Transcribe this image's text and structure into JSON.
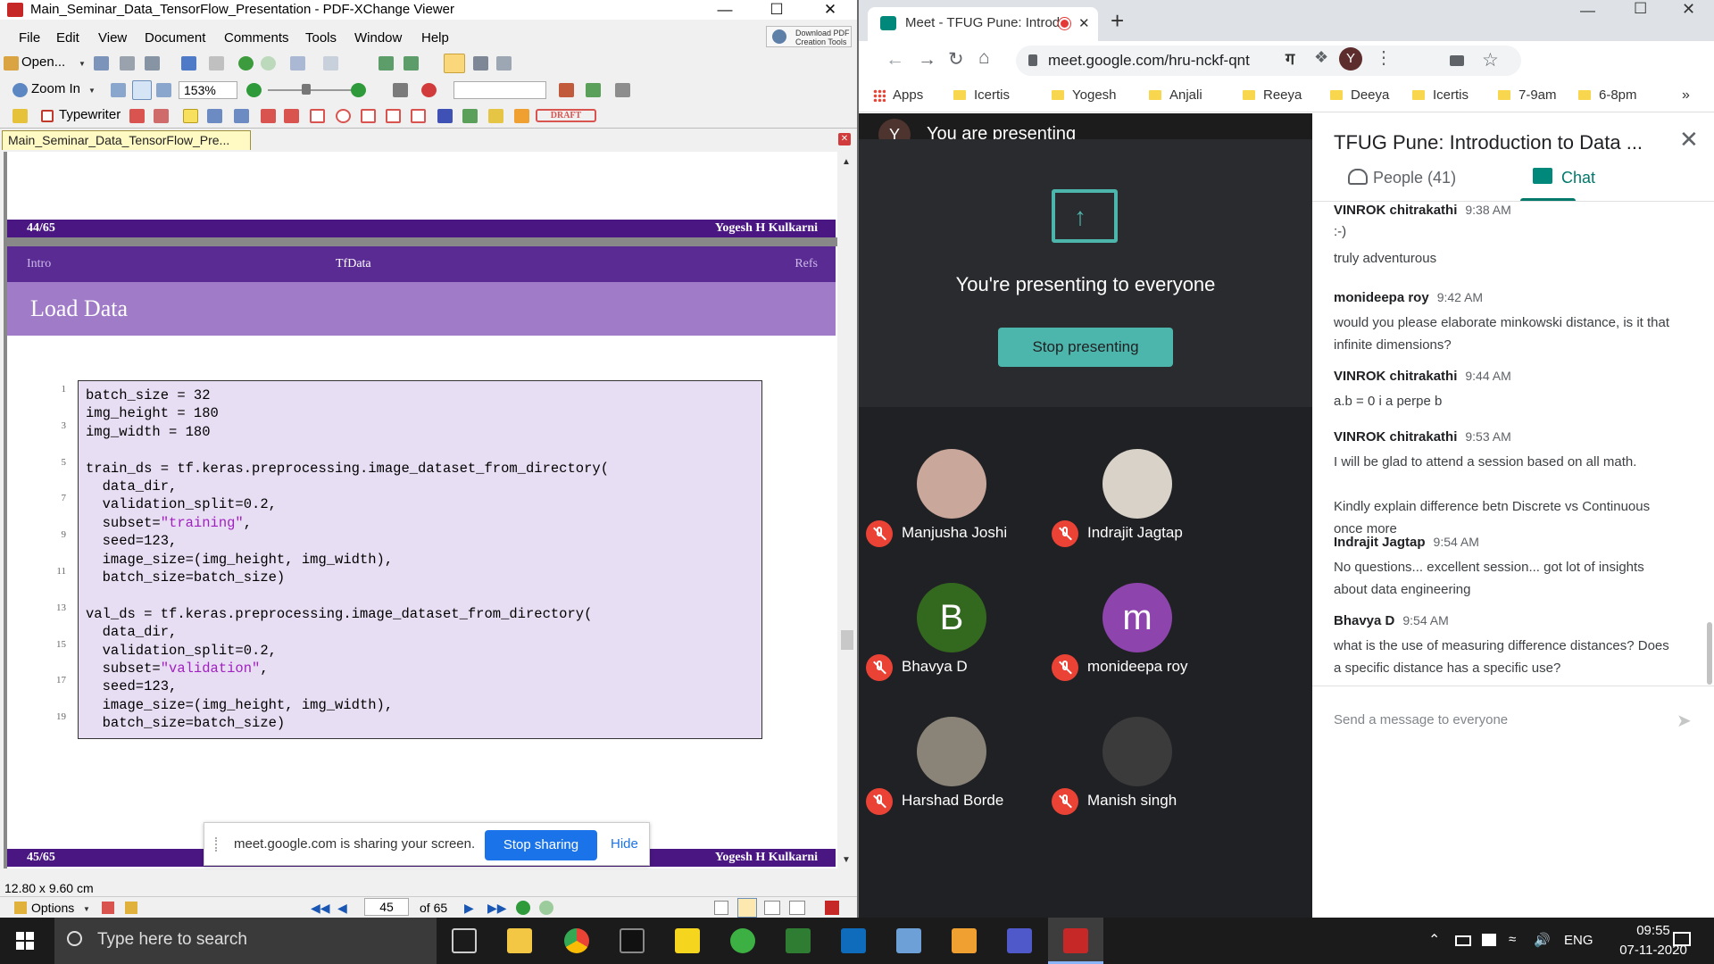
{
  "pdf": {
    "window_title": "Main_Seminar_Data_TensorFlow_Presentation - PDF-XChange Viewer",
    "menu": [
      "File",
      "Edit",
      "View",
      "Document",
      "Comments",
      "Tools",
      "Window",
      "Help"
    ],
    "open_label": "Open...",
    "download_label": "Download PDF Creation Tools",
    "zoom_label": "Zoom In",
    "zoom_value": "153%",
    "typewriter_label": "Typewriter",
    "draft_label": "DRAFT",
    "doc_tab": "Main_Seminar_Data_TensorFlow_Pre...",
    "page_prev_footer": {
      "page": "44/65",
      "author": "Yogesh H Kulkarni"
    },
    "slide_nav": {
      "left": "Intro",
      "center": "TfData",
      "right": "Refs"
    },
    "slide_title": "Load Data",
    "code_lines": [
      {
        "num": "1",
        "text": "batch_size = 32"
      },
      {
        "num": "",
        "text": "img_height = 180"
      },
      {
        "num": "3",
        "text": "img_width = 180"
      },
      {
        "num": "",
        "text": ""
      },
      {
        "num": "5",
        "text": "train_ds = tf.keras.preprocessing.image_dataset_from_directory("
      },
      {
        "num": "",
        "text": "  data_dir,"
      },
      {
        "num": "7",
        "text": "  validation_split=0.2,"
      },
      {
        "num": "",
        "pre": "  subset=",
        "str": "\"training\"",
        "post": ","
      },
      {
        "num": "9",
        "text": "  seed=123,"
      },
      {
        "num": "",
        "text": "  image_size=(img_height, img_width),"
      },
      {
        "num": "11",
        "text": "  batch_size=batch_size)"
      },
      {
        "num": "",
        "text": ""
      },
      {
        "num": "13",
        "text": "val_ds = tf.keras.preprocessing.image_dataset_from_directory("
      },
      {
        "num": "",
        "text": "  data_dir,"
      },
      {
        "num": "15",
        "text": "  validation_split=0.2,"
      },
      {
        "num": "",
        "pre": "  subset=",
        "str": "\"validation\"",
        "post": ","
      },
      {
        "num": "17",
        "text": "  seed=123,"
      },
      {
        "num": "",
        "text": "  image_size=(img_height, img_width),"
      },
      {
        "num": "19",
        "text": "  batch_size=batch_size)"
      }
    ],
    "page_cur_footer": {
      "page": "45/65",
      "author": "Yogesh H Kulkarni"
    },
    "share_notice": "meet.google.com is sharing your screen.",
    "stop_sharing": "Stop sharing",
    "hide": "Hide",
    "page_size": "12.80 x 9.60 cm",
    "options_label": "Options",
    "page_number": "45",
    "page_total": "of 65"
  },
  "chrome": {
    "tab_title": "Meet - TFUG Pune: Introducti",
    "url": "meet.google.com/hru-nckf-qnt",
    "profile_initial": "Y",
    "bookmarks": [
      "Apps",
      "Icertis",
      "Yogesh",
      "Anjali",
      "Reeya",
      "Deeya",
      "Icertis",
      "7-9am",
      "6-8pm"
    ]
  },
  "meet": {
    "presenter_initial": "Y",
    "presenting_header": "You are presenting",
    "presenting_msg": "You're presenting to everyone",
    "stop_presenting": "Stop presenting",
    "participants": [
      {
        "name": "Manjusha Joshi",
        "initial": "",
        "color": "#c9a79a"
      },
      {
        "name": "Indrajit Jagtap",
        "initial": "",
        "color": "#d8d2c8"
      },
      {
        "name": "Bhavya D",
        "initial": "B",
        "color": "#33691e"
      },
      {
        "name": "monideepa roy",
        "initial": "m",
        "color": "#8e44ad"
      },
      {
        "name": "Harshad Borde",
        "initial": "",
        "color": "#8a8478"
      },
      {
        "name": "Manish singh",
        "initial": "",
        "color": "#3b3b3b"
      }
    ],
    "meeting_title": "TFUG Pune: Introduction to Data ...",
    "people_tab": "People (41)",
    "chat_tab": "Chat",
    "chat": [
      {
        "name": "VINROK chitrakathi",
        "time": "9:38 AM",
        "lines": [
          ":-)",
          "truly adventurous"
        ]
      },
      {
        "name": "monideepa roy",
        "time": "9:42 AM",
        "lines": [
          "would you please elaborate minkowski distance, is it that infinite dimensions?"
        ]
      },
      {
        "name": "VINROK chitrakathi",
        "time": "9:44 AM",
        "lines": [
          "a.b = 0 i a perpe b"
        ]
      },
      {
        "name": "VINROK chitrakathi",
        "time": "9:53 AM",
        "lines": [
          "I will be glad to attend a session based on all math.",
          "Kindly explain difference betn Discrete vs Continuous once more"
        ]
      },
      {
        "name": "Indrajit Jagtap",
        "time": "9:54 AM",
        "lines": [
          "No questions... excellent session... got lot of insights about data engineering"
        ]
      },
      {
        "name": "Bhavya D",
        "time": "9:54 AM",
        "lines": [
          "what is the use of measuring difference distances? Does a specific distance has a specific use?"
        ]
      }
    ],
    "message_placeholder": "Send a message to everyone"
  },
  "taskbar": {
    "search_placeholder": "Type here to search",
    "language": "ENG",
    "time": "09:55",
    "date": "07-11-2020"
  },
  "colors": {
    "slide_dark": "#4a1782",
    "slide_title": "#a07bc8",
    "code_bg": "#e8def3",
    "meet_teal": "#4db6ac",
    "meet_dark": "#202124",
    "chrome_blue": "#1a73e8"
  }
}
